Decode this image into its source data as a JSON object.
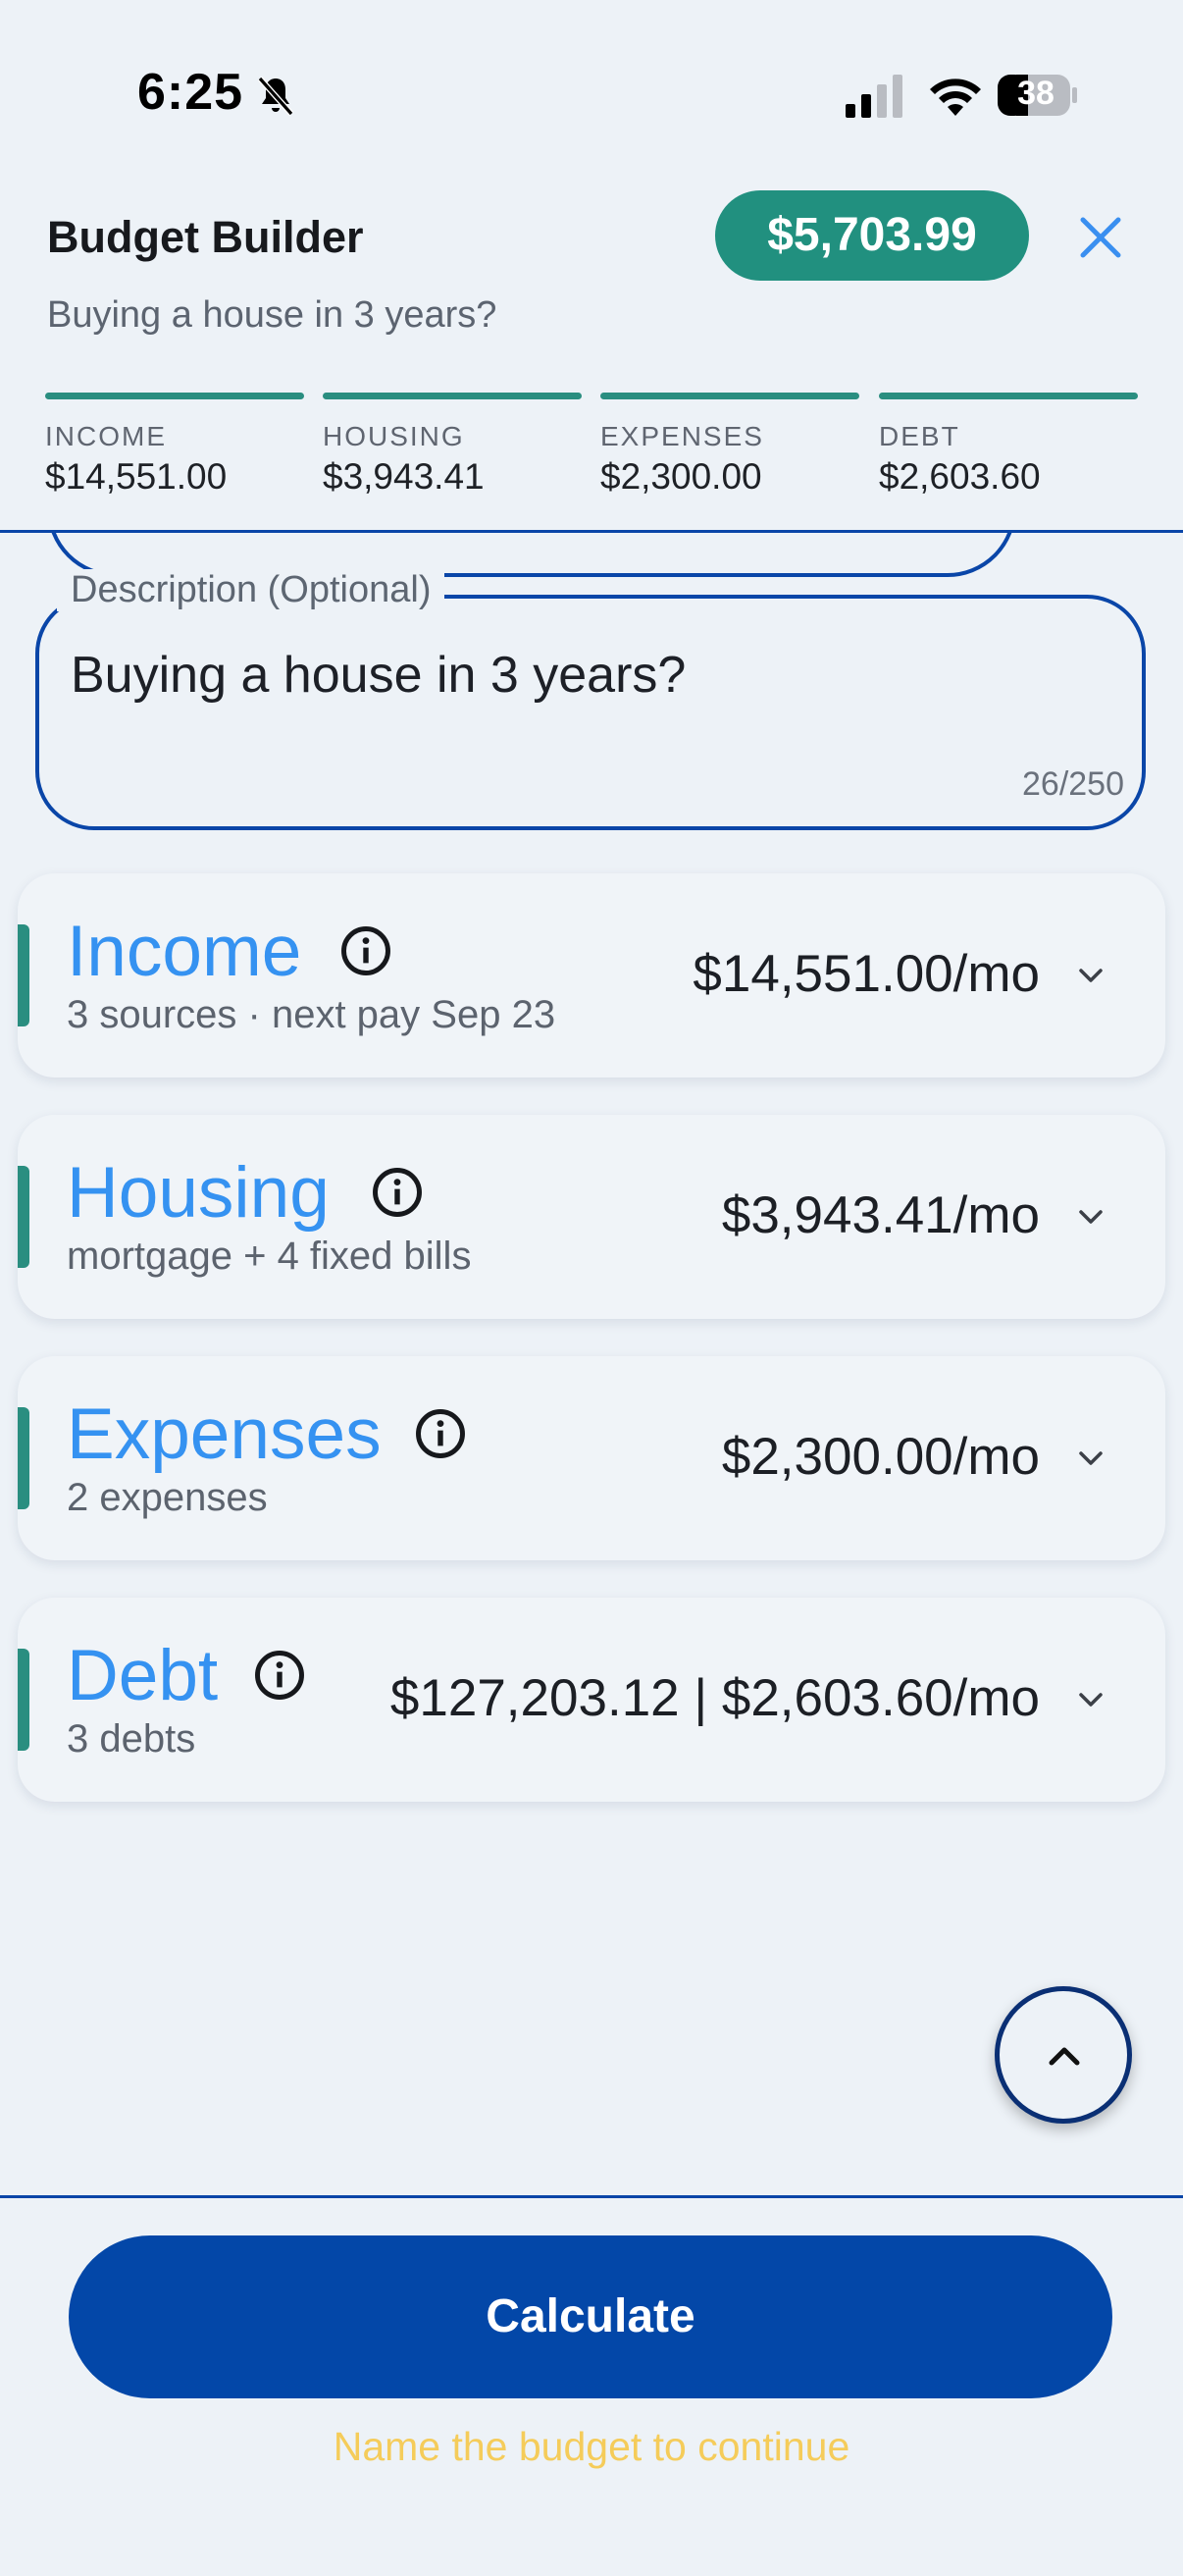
{
  "status_bar": {
    "time": "6:25",
    "battery": "38"
  },
  "header": {
    "title": "Budget Builder",
    "subtitle": "Buying a house in 3 years?",
    "total": "$5,703.99",
    "summary": [
      {
        "label": "INCOME",
        "value": "$14,551.00"
      },
      {
        "label": "HOUSING",
        "value": "$3,943.41"
      },
      {
        "label": "EXPENSES",
        "value": "$2,300.00"
      },
      {
        "label": "DEBT",
        "value": "$2,603.60"
      }
    ]
  },
  "description": {
    "label": "Description (Optional)",
    "value": "Buying a house in 3 years?",
    "counter": "26/250"
  },
  "sections": [
    {
      "title": "Income",
      "subtitle": "3 sources · next pay Sep 23",
      "amount": "$14,551.00/mo"
    },
    {
      "title": "Housing",
      "subtitle": "mortgage + 4 fixed bills",
      "amount": "$3,943.41/mo"
    },
    {
      "title": "Expenses",
      "subtitle": "2 expenses",
      "amount": "$2,300.00/mo"
    },
    {
      "title": "Debt",
      "subtitle": "3 debts",
      "amount": "$127,203.12 | $2,603.60/mo"
    }
  ],
  "footer": {
    "button_label": "Calculate",
    "hint": "Name the budget to continue"
  },
  "colors": {
    "accent_teal": "#21907f",
    "primary_blue": "#0347a8",
    "section_title_blue": "#3592f1",
    "hint_yellow": "#f5cc5a"
  }
}
